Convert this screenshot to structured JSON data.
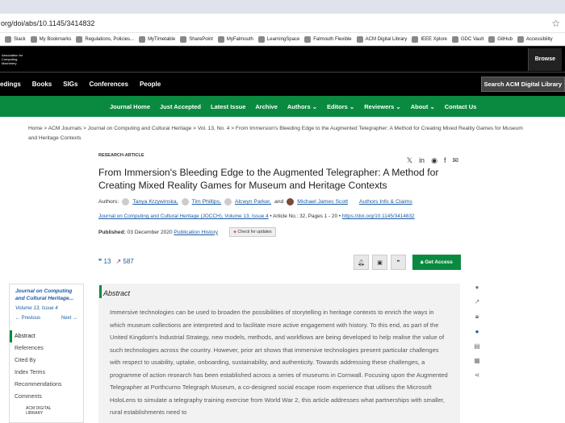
{
  "browser": {
    "url": "org/doi/abs/10.1145/3414832",
    "star_icon": "star-icon",
    "bookmarks": [
      "Slack",
      "My Bookmarks",
      "Regulations, Policies...",
      "MyTimetable",
      "SharePoint",
      "MyFalmouth",
      "LearningSpace",
      "Falmouth Flexible",
      "ACM Digital Library",
      "IEEE Xplore",
      "GDC Vault",
      "GitHub",
      "Accessibility"
    ]
  },
  "acm": {
    "logo_text": "Association for Computing Machinery",
    "browse": "Browse",
    "nav": [
      "edings",
      "Books",
      "SIGs",
      "Conferences",
      "People"
    ],
    "search": "Search ACM Digital Library",
    "journal_nav": [
      "Journal Home",
      "Just Accepted",
      "Latest Issue",
      "Archive",
      "Authors ⌄",
      "Editors ⌄",
      "Reviewers ⌄",
      "About ⌄",
      "Contact Us"
    ]
  },
  "breadcrumb": {
    "text": "Home  >  ACM Journals  >  Journal on Computing and Cultural Heritage  >  Vol. 13, No. 4  >  From Immersion's Bleeding Edge to the Augmented Telegrapher: A Method for Creating Mixed Reality Games for Museum and Heritage Contexts"
  },
  "article": {
    "type": "RESEARCH-ARTICLE",
    "title": "From Immersion's Bleeding Edge to the Augmented Telegrapher: A Method for Creating Mixed Reality Games for Museum and Heritage Contexts",
    "authors_label": "Authors:",
    "authors": [
      "Tanya Krzywinska,",
      "Tim Phillips,",
      "Alcwyn Parker,",
      "and",
      "Michael James Scott"
    ],
    "authors_info": "Authors Info & Claims",
    "journal_ref": "Journal on Computing and Cultural Heritage (JOCCH), Volume 13, Issue 4",
    "journal_meta": " • Article No.: 32, Pages 1 - 20 • ",
    "doi": "https://doi.org/10.1145/3414832",
    "published_label": "Published:",
    "published_date": "03 December 2020",
    "pub_history": "Publication History",
    "check_updates": "Check for updates",
    "citations": "13",
    "downloads": "587",
    "get_access": "Get Access"
  },
  "sidebar": {
    "journal": "Journal on Computing and Cultural Heritage...",
    "volume": "Volume 13, Issue 4",
    "prev": "← Previous",
    "next": "Next →",
    "items": [
      "Abstract",
      "References",
      "Cited By",
      "Index Terms",
      "Recommendations",
      "Comments"
    ],
    "footer": "ACM DIGITAL LIBRARY"
  },
  "abstract": {
    "heading": "Abstract",
    "text": "Immersive technologies can be used to broaden the possibilities of storytelling in heritage contexts to enrich the ways in which museum collections are interpreted and to facilitate more active engagement with history. To this end, as part of the United Kingdom's Industrial Strategy, new models, methods, and workflows are being developed to help realise the value of such technologies across the country. However, prior art shows that immersive technologies present particular challenges with respect to usability, uptake, onboarding, sustainability, and authenticity. Towards addressing these challenges, a programme of action research has been established across a series of museums in Cornwall. Focusing upon the Augmented Telegrapher at Porthcurno Telegraph Museum, a co-designed social escape room experience that utilises the Microsoft HoloLens to simulate a telegraphy training exercise from World War 2, this article addresses what partnerships with smaller, rural establishments need to"
  },
  "colors": {
    "green": "#0a8a40",
    "black": "#000000",
    "link": "#1a5aa0"
  }
}
